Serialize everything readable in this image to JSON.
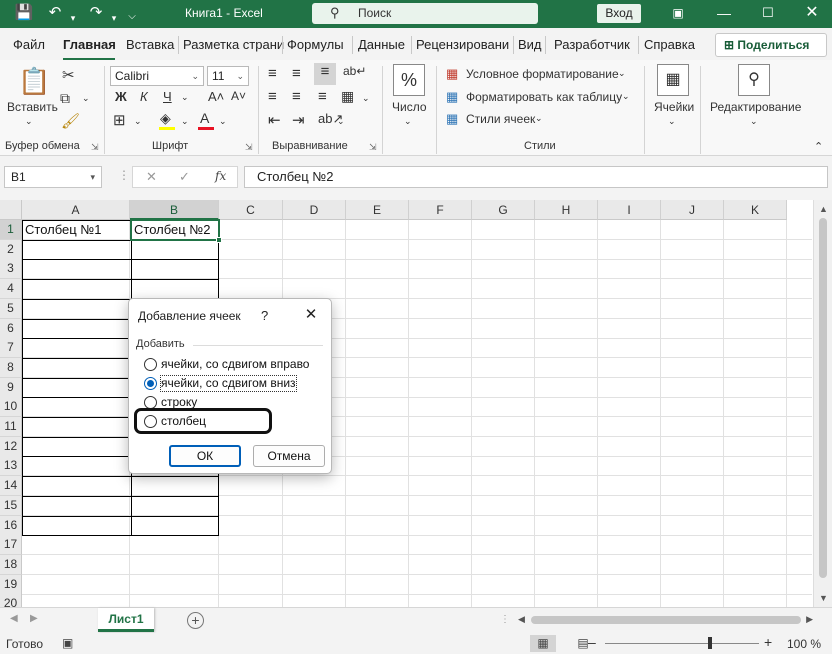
{
  "titlebar": {
    "doc_title": "Книга1  -  Excel",
    "search_placeholder": "Поиск",
    "signin": "Вход",
    "bg_color": "#217346"
  },
  "tabs": [
    "Файл",
    "Главная",
    "Вставка",
    "Разметка страни",
    "Формулы",
    "Данные",
    "Рецензировани",
    "Вид",
    "Разработчик",
    "Справка"
  ],
  "active_tab": "Главная",
  "share_label": "Поделиться",
  "ribbon": {
    "clipboard": {
      "paste": "Вставить",
      "label": "Буфер обмена"
    },
    "font": {
      "name": "Calibri",
      "size": "11",
      "bold": "Ж",
      "italic": "К",
      "underline": "Ч",
      "grow": "A˄",
      "shrink": "A˅",
      "label": "Шрифт"
    },
    "alignment": {
      "label": "Выравнивание"
    },
    "number": {
      "symbol": "%",
      "label": "Число"
    },
    "styles": {
      "cond_format": "Условное форматирование",
      "format_table": "Форматировать как таблицу",
      "cell_styles": "Стили ячеек",
      "label": "Стили"
    },
    "cells": {
      "label": "Ячейки"
    },
    "editing": {
      "label": "Редактирование"
    }
  },
  "formula_bar": {
    "name_box": "B1",
    "formula": "Столбец №2",
    "fx": "fx"
  },
  "grid": {
    "columns": [
      "A",
      "B",
      "C",
      "D",
      "E",
      "F",
      "G",
      "H",
      "I",
      "J",
      "K"
    ],
    "rows": [
      "1",
      "2",
      "3",
      "4",
      "5",
      "6",
      "7",
      "8",
      "9",
      "10",
      "11",
      "12",
      "13",
      "14",
      "15",
      "16",
      "17",
      "18",
      "19",
      "20"
    ],
    "selected_column": "B",
    "selected_row": "1",
    "cell_A1": "Столбец №1",
    "cell_B1": "Столбец №2"
  },
  "sheets": {
    "active": "Лист1"
  },
  "status": {
    "ready": "Готово",
    "zoom": "100 %"
  },
  "dialog": {
    "title": "Добавление ячеек",
    "help": "?",
    "group_label": "Добавить",
    "options": [
      {
        "label": "ячейки, со сдвигом вправо",
        "selected": false
      },
      {
        "label": "ячейки, со сдвигом вниз",
        "selected": true
      },
      {
        "label": "строку",
        "selected": false
      },
      {
        "label": "столбец",
        "selected": false
      }
    ],
    "ok": "ОК",
    "cancel": "Отмена"
  }
}
